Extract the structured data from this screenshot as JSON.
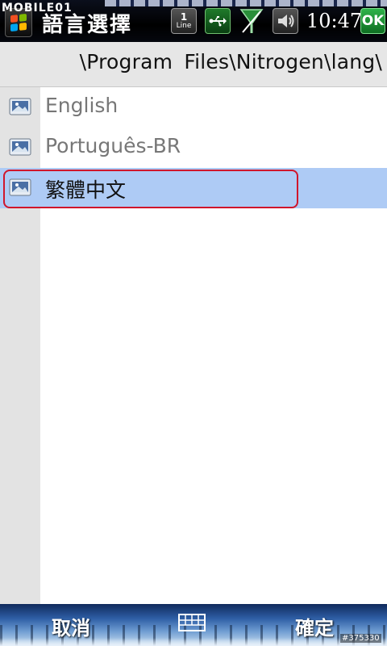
{
  "status_bar": {
    "watermark": "MOBILE01",
    "app_title": "語言選擇",
    "line_count": "1",
    "line_label": "Line",
    "time": "10:47",
    "ok_label": "OK",
    "icons": [
      "windows-start-icon",
      "line-icon",
      "usb-icon",
      "signal-icon",
      "speaker-icon"
    ]
  },
  "path": "\\Program Files\\Nitrogen\\lang\\",
  "files": [
    {
      "label": "English",
      "selected": false
    },
    {
      "label": "Português-BR",
      "selected": false
    },
    {
      "label": "繁體中文",
      "selected": true
    }
  ],
  "softkeys": {
    "left": "取消",
    "right": "確定",
    "center_icon": "keyboard-icon"
  },
  "image_id": "#375330",
  "colors": {
    "selection": "#aecbf5",
    "highlight_border": "#d0162c",
    "ok_green": "#1e9c38"
  }
}
